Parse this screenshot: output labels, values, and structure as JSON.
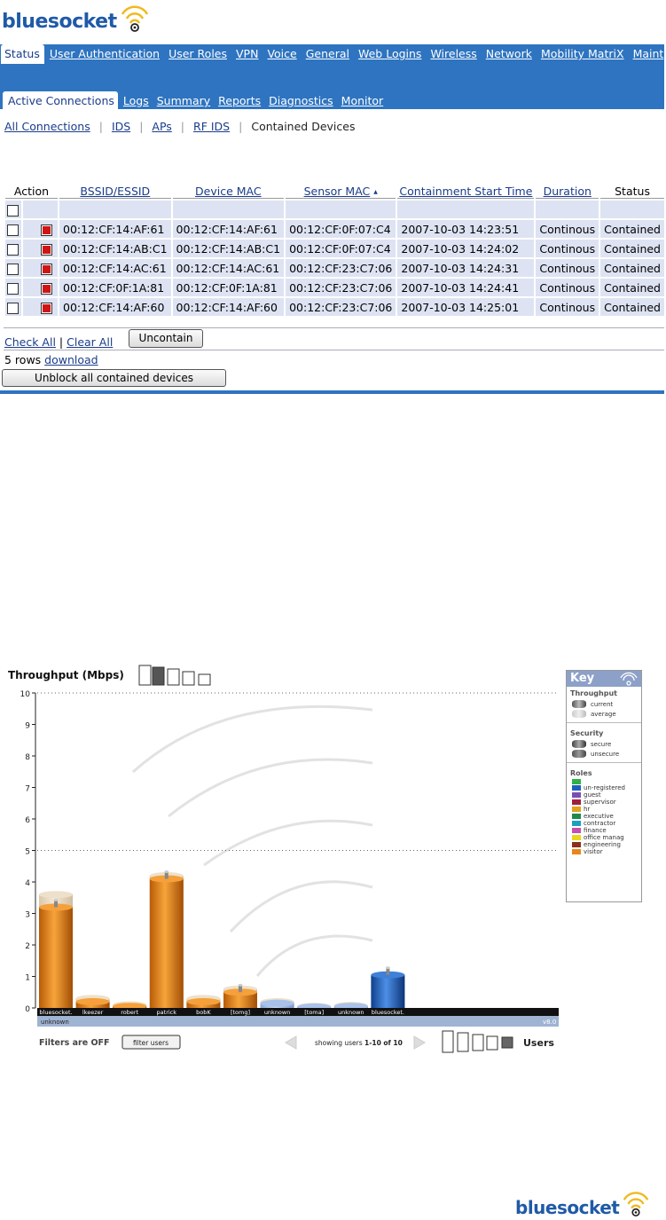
{
  "top_logo": {
    "text": "bluesocket"
  },
  "nav": {
    "tabs": [
      "Status",
      "User Authentication",
      "User Roles",
      "VPN",
      "Voice",
      "General",
      "Web Logins",
      "Wireless",
      "Network",
      "Mobility MatriX",
      "Maint"
    ],
    "selected_tab": 0,
    "subtabs": [
      "Active Connections",
      "Logs",
      "Summary",
      "Reports",
      "Diagnostics",
      "Monitor"
    ],
    "selected_subtab": 0
  },
  "subnav": {
    "all_connections": "All Connections",
    "ids": "IDS",
    "aps": "APs",
    "rf_ids": "RF IDS",
    "contained_devices": "Contained Devices",
    "separator": "|"
  },
  "table": {
    "headers": {
      "action": "Action",
      "bssid": "BSSID/ESSID",
      "device_mac": "Device MAC",
      "sensor_mac": "Sensor MAC",
      "sort_mark": "▲",
      "start_time": "Containment Start Time",
      "duration": "Duration",
      "status": "Status"
    },
    "rows": [
      {
        "bssid": "00:12:CF:14:AF:61",
        "device_mac": "00:12:CF:14:AF:61",
        "sensor_mac": "00:12:CF:0F:07:C4",
        "start_time": "2007-10-03 14:23:51",
        "duration": "Continous",
        "status": "Contained"
      },
      {
        "bssid": "00:12:CF:14:AB:C1",
        "device_mac": "00:12:CF:14:AB:C1",
        "sensor_mac": "00:12:CF:0F:07:C4",
        "start_time": "2007-10-03 14:24:02",
        "duration": "Continous",
        "status": "Contained"
      },
      {
        "bssid": "00:12:CF:14:AC:61",
        "device_mac": "00:12:CF:14:AC:61",
        "sensor_mac": "00:12:CF:23:C7:06",
        "start_time": "2007-10-03 14:24:31",
        "duration": "Continous",
        "status": "Contained"
      },
      {
        "bssid": "00:12:CF:0F:1A:81",
        "device_mac": "00:12:CF:0F:1A:81",
        "sensor_mac": "00:12:CF:23:C7:06",
        "start_time": "2007-10-03 14:24:41",
        "duration": "Continous",
        "status": "Contained"
      },
      {
        "bssid": "00:12:CF:14:AF:60",
        "device_mac": "00:12:CF:14:AF:60",
        "sensor_mac": "00:12:CF:23:C7:06",
        "start_time": "2007-10-03 14:25:01",
        "duration": "Continous",
        "status": "Contained"
      }
    ]
  },
  "actions": {
    "check_all": "Check All",
    "pipe": "|",
    "clear_all": "Clear All",
    "uncontain": "Uncontain",
    "rows_count": "5 rows",
    "download": "download",
    "unblock_all": "Unblock all contained devices"
  },
  "chart_data": {
    "type": "bar",
    "title": "Throughput (Mbps)",
    "ylim": [
      0,
      10
    ],
    "yticks": [
      "0",
      "1",
      "2",
      "3",
      "4",
      "5",
      "6",
      "7",
      "8",
      "9",
      "10"
    ],
    "categories": [
      "bluesocket.",
      "lkeezer",
      "robert",
      "patrick",
      "bobK",
      "[tomg]",
      "unknown",
      "[toma]",
      "unknown",
      "bluesocket."
    ],
    "series": [
      {
        "name": "current",
        "values": [
          3.2,
          0.2,
          0.05,
          4.1,
          0.2,
          0.5,
          0.15,
          0.03,
          0.05,
          1.05
        ]
      },
      {
        "name": "average",
        "values": [
          3.6,
          0.3,
          0.1,
          4.2,
          0.3,
          0.6,
          0.2,
          0.05,
          0.08,
          1.05
        ]
      }
    ],
    "bar_colors": [
      "#e8861a",
      "#e8861a",
      "#e8861a",
      "#e8861a",
      "#e8861a",
      "#e8861a",
      "#6f9ad8",
      "#6f9ad8",
      "#6f9ad8",
      "#1f5ec0"
    ],
    "selected_user": "unknown",
    "version": "v8.0",
    "filters_label": "Filters are OFF",
    "filter_button": "filter users",
    "pager_prefix": "showing users ",
    "pager_range": "1-10 of 10",
    "users_label": "Users",
    "key": {
      "title": "Key",
      "throughput_label": "Throughput",
      "throughput_items": [
        "current",
        "average"
      ],
      "security_label": "Security",
      "security_items": [
        "secure",
        "unsecure"
      ],
      "roles_label": "Roles",
      "roles": [
        "",
        "un-registered",
        "guest",
        "supervisor",
        "hr",
        "executive",
        "contractor",
        "finance",
        "office manag",
        "engineering",
        "visitor"
      ],
      "role_colors": [
        "#2fb14a",
        "#1f5ec0",
        "#7b4fb0",
        "#a01f3f",
        "#e1a21c",
        "#1f8a4a",
        "#1f9fbf",
        "#c34fb0",
        "#e8d81c",
        "#8b2f1f",
        "#e8861a"
      ]
    }
  },
  "bottom_logo": {
    "text": "bluesocket"
  },
  "colors": {
    "nav_blue": "#2e74c0",
    "row_bg": "#dde3f2",
    "link": "#1a3c8c",
    "brand": "#1f5aa8",
    "wifi": "#f0b91c"
  }
}
